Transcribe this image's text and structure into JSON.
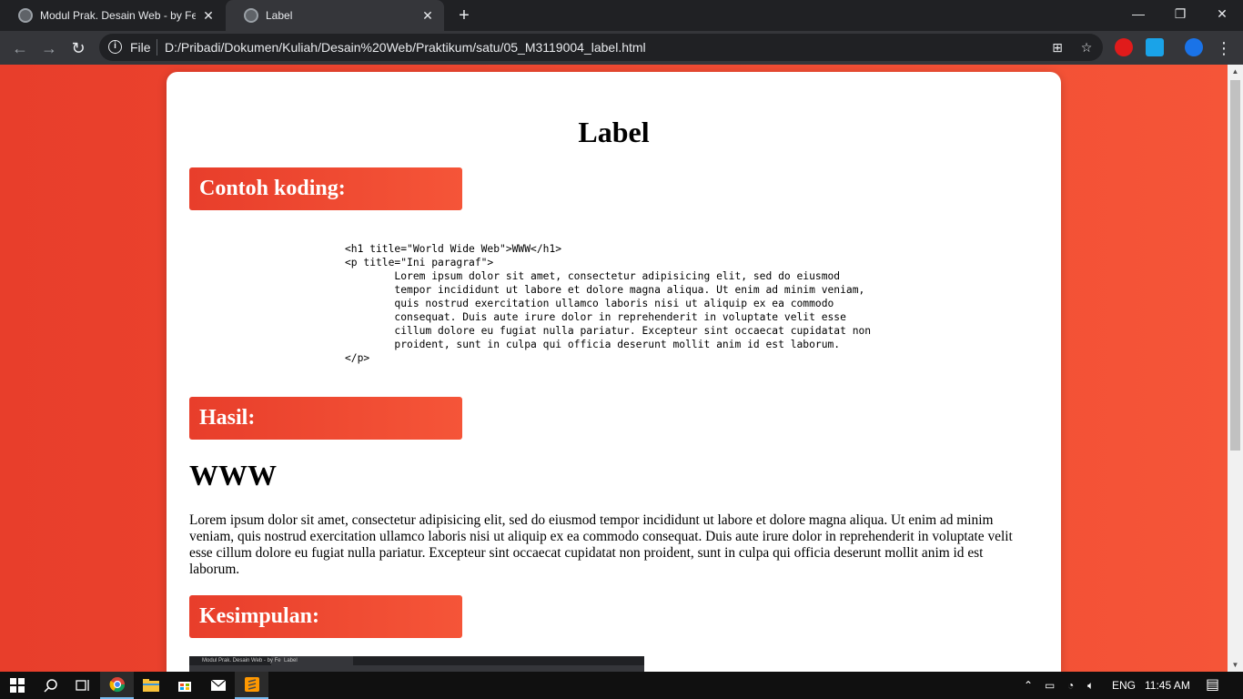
{
  "browser": {
    "tabs": [
      {
        "title": "Modul Prak. Desain Web - by Fer",
        "close": "✕"
      },
      {
        "title": "Label",
        "close": "✕"
      }
    ],
    "new_tab": "+",
    "window_controls": {
      "minimize": "—",
      "restore": "❐",
      "close": "✕"
    },
    "nav": {
      "back": "←",
      "forward": "→",
      "reload": "↻"
    },
    "address": {
      "info": "i",
      "scheme_label": "File",
      "url": "D:/Pribadi/Dokumen/Kuliah/Desain%20Web/Praktikum/satu/05_M3119004_label.html"
    },
    "icons": {
      "translate": "⊞",
      "bookmark": "☆"
    }
  },
  "page": {
    "title": "Label",
    "sections": {
      "code": "Contoh koding:",
      "result": "Hasil:",
      "conclusion": "Kesimpulan:"
    },
    "code_sample": "<h1 title=\"World Wide Web\">WWW</h1>\n<p title=\"Ini paragraf\">\n        Lorem ipsum dolor sit amet, consectetur adipisicing elit, sed do eiusmod\n        tempor incididunt ut labore et dolore magna aliqua. Ut enim ad minim veniam,\n        quis nostrud exercitation ullamco laboris nisi ut aliquip ex ea commodo\n        consequat. Duis aute irure dolor in reprehenderit in voluptate velit esse\n        cillum dolore eu fugiat nulla pariatur. Excepteur sint occaecat cupidatat non\n        proident, sunt in culpa qui officia deserunt mollit anim id est laborum.\n</p>",
    "result_heading": "WWW",
    "result_paragraph": "Lorem ipsum dolor sit amet, consectetur adipisicing elit, sed do eiusmod tempor incididunt ut labore et dolore magna aliqua. Ut enim ad minim veniam, quis nostrud exercitation ullamco laboris nisi ut aliquip ex ea commodo consequat. Duis aute irure dolor in reprehenderit in voluptate velit esse cillum dolore eu fugiat nulla pariatur. Excepteur sint occaecat cupidatat non proident, sunt in culpa qui officia deserunt mollit anim id est laborum.",
    "screenshot_tabs": [
      "Modul Prak. Desain Web - by Fe",
      "Label"
    ]
  },
  "taskbar": {
    "language": "ENG",
    "time": "11:45 AM"
  },
  "colors": {
    "accent_start": "#e83e2b",
    "accent_end": "#f55538"
  }
}
